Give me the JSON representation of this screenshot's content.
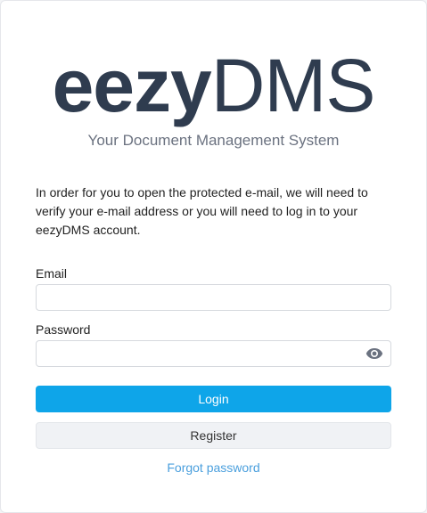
{
  "logo": {
    "bold_part": "eezy",
    "light_part": "DMS"
  },
  "tagline": "Your Document Management System",
  "intro_text": "In order for you to open the protected e-mail, we will need to verify your e-mail address or you will need to log in to your eezyDMS account.",
  "form": {
    "email_label": "Email",
    "email_value": "",
    "password_label": "Password",
    "password_value": "",
    "login_label": "Login",
    "register_label": "Register",
    "forgot_label": "Forgot password"
  },
  "colors": {
    "primary": "#0ea5e9",
    "logo": "#2f3c4f",
    "link": "#4a9fdd"
  },
  "icons": {
    "password_toggle": "eye-icon"
  }
}
